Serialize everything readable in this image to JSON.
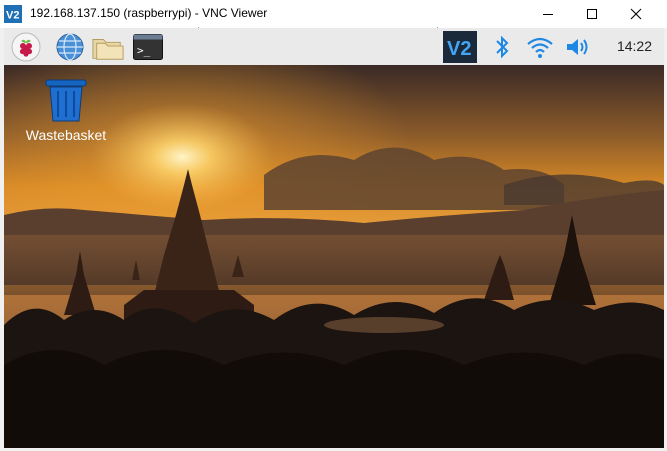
{
  "window": {
    "title": "192.168.137.150 (raspberrypi) - VNC Viewer",
    "controls": [
      "minimize",
      "maximize",
      "close"
    ]
  },
  "panel": {
    "launchers": [
      {
        "name": "raspberry-menu-icon"
      },
      {
        "name": "web-browser-icon"
      },
      {
        "name": "file-manager-icon"
      },
      {
        "name": "terminal-icon"
      }
    ],
    "tray": [
      {
        "name": "vnc-server-icon"
      },
      {
        "name": "bluetooth-icon"
      },
      {
        "name": "wifi-icon"
      },
      {
        "name": "volume-icon"
      }
    ],
    "clock": "14:22"
  },
  "desktop": {
    "icons": [
      {
        "label": "Wastebasket",
        "icon": "trash-icon"
      }
    ],
    "wallpaper": "temple sunset"
  },
  "colors": {
    "vnc_blue": "#1f6fb5",
    "panel_bg": "#eaeaea",
    "tray_blue": "#1e88e5",
    "sky_top": "#3a2a26",
    "sun": "#fff4c8"
  }
}
